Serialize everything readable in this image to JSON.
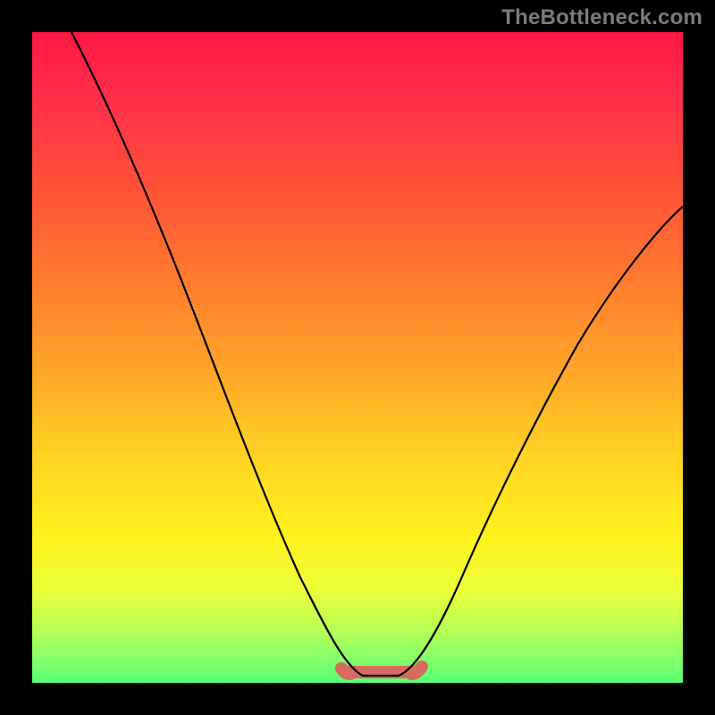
{
  "watermark": "TheBottleneck.com",
  "colors": {
    "frame": "#000000",
    "curve": "#000000",
    "band": "#d86a5e",
    "gradient_stops": [
      "#ff1744",
      "#ff2e4a",
      "#ff5436",
      "#ff7b2f",
      "#ffa528",
      "#ffd223",
      "#fff31f",
      "#e9ff3a",
      "#b6ff55",
      "#5aff7a"
    ]
  },
  "chart_data": {
    "type": "line",
    "title": "",
    "xlabel": "",
    "ylabel": "",
    "xlim": [
      0,
      100
    ],
    "ylim": [
      0,
      100
    ],
    "series": [
      {
        "name": "bottleneck-curve",
        "x": [
          6,
          10,
          15,
          20,
          25,
          30,
          35,
          40,
          43,
          46,
          48,
          50,
          52,
          54,
          56,
          58,
          60,
          65,
          70,
          75,
          80,
          85,
          90,
          95,
          100
        ],
        "y": [
          100,
          93,
          84,
          74,
          64,
          53,
          42,
          30,
          20,
          11,
          5,
          2,
          1,
          1,
          2,
          5,
          10,
          22,
          33,
          43,
          51,
          58,
          64,
          69,
          73
        ]
      }
    ],
    "flat_region": {
      "x_start": 48,
      "x_end": 58,
      "y": 1
    },
    "annotations": []
  }
}
